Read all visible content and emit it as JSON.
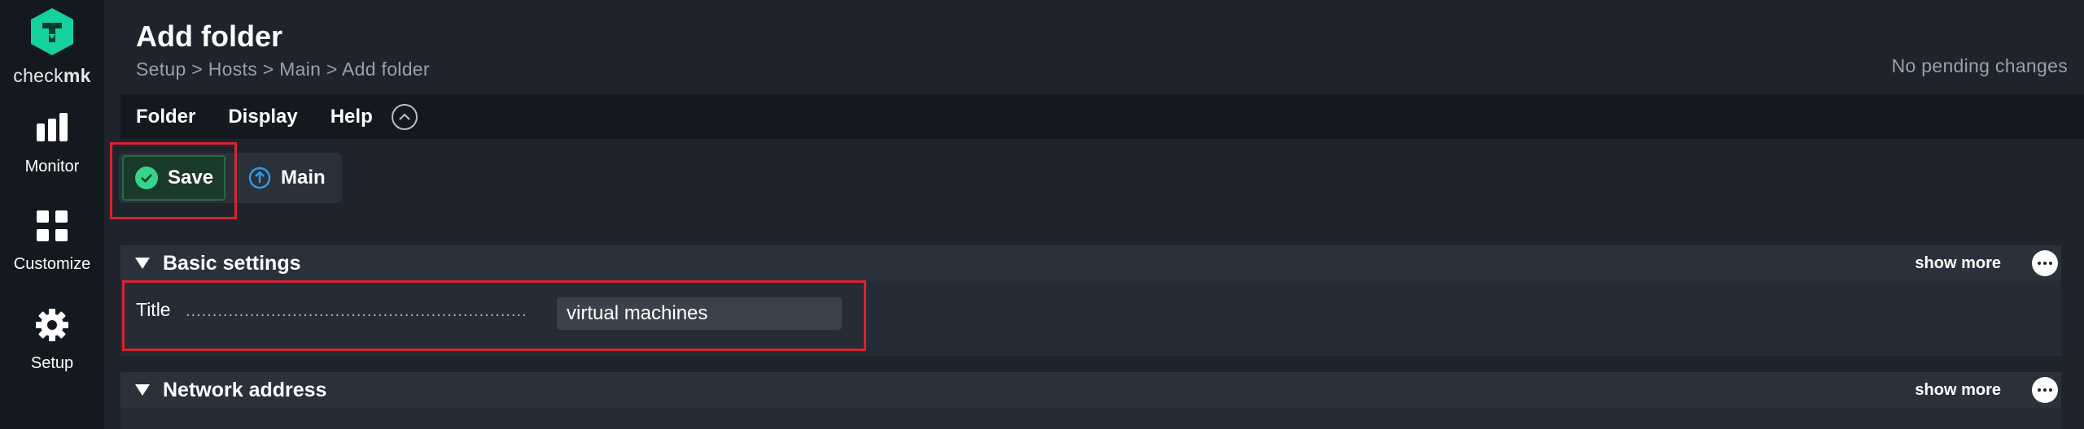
{
  "app": {
    "logo_prefix": "check",
    "logo_suffix": "mk",
    "logo_icon": "checkmk-logo-icon"
  },
  "sidebar": {
    "items": [
      {
        "label": "Monitor",
        "icon": "bar-chart-icon"
      },
      {
        "label": "Customize",
        "icon": "grid-icon"
      },
      {
        "label": "Setup",
        "icon": "gear-icon"
      }
    ]
  },
  "header": {
    "title": "Add folder",
    "breadcrumb": "Setup > Hosts > Main > Add folder",
    "pending": "No pending changes"
  },
  "menubar": {
    "items": [
      "Folder",
      "Display",
      "Help"
    ],
    "collapse_icon": "chevron-up-circle-icon"
  },
  "toolbar": {
    "save_label": "Save",
    "main_label": "Main",
    "save_icon": "check-circle-icon",
    "main_icon": "arrow-up-circle-icon"
  },
  "sections": [
    {
      "title": "Basic settings",
      "show_more": "show more"
    },
    {
      "title": "Network address",
      "show_more": "show more"
    }
  ],
  "basic_settings": {
    "title_label": "Title",
    "title_value": "virtual machines"
  },
  "colors": {
    "accent_green": "#35d58c",
    "highlight_red": "#d8242e",
    "main_blue": "#2f9be8",
    "sidebar_bg": "#14191f",
    "page_bg": "#1e232c"
  }
}
